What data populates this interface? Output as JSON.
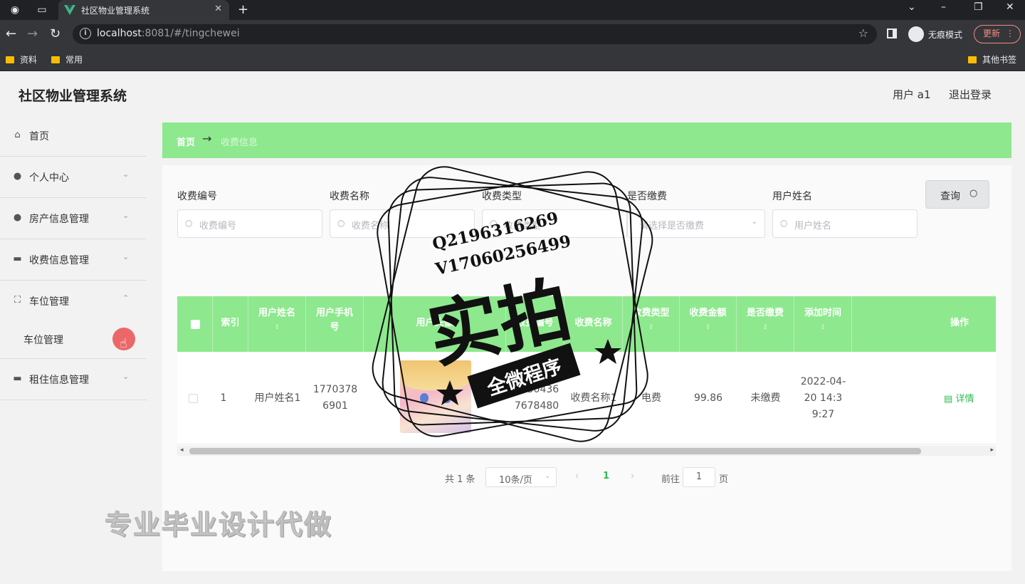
{
  "browser": {
    "tab_title": "社区物业管理系统",
    "url_host": "localhost",
    "url_rest": ":8081/#/tingchewei",
    "incognito_label": "无痕模式",
    "update_label": "更新",
    "bookmarks": [
      "资料",
      "常用"
    ],
    "other_bookmarks": "其他书签"
  },
  "app": {
    "title": "社区物业管理系统",
    "user_label": "用户 a1",
    "logout_label": "退出登录"
  },
  "sidebar": {
    "items": [
      {
        "label": "首页",
        "icon": "home-icon"
      },
      {
        "label": "个人中心",
        "icon": "user-icon"
      },
      {
        "label": "房产信息管理",
        "icon": "user-icon"
      },
      {
        "label": "收费信息管理",
        "icon": "monitor-icon"
      },
      {
        "label": "车位管理",
        "icon": "fullscreen-icon"
      },
      {
        "label": "租住信息管理",
        "icon": "monitor-icon"
      }
    ],
    "sub_item": "车位管理"
  },
  "breadcrumb": {
    "home": "首页",
    "current": "收费信息"
  },
  "filters": {
    "fields": [
      {
        "label": "收费编号",
        "placeholder": "收费编号"
      },
      {
        "label": "收费名称",
        "placeholder": "收费名称"
      },
      {
        "label": "收费类型",
        "placeholder": "收费类型"
      },
      {
        "label": "是否缴费",
        "placeholder": "请选择是否缴费"
      },
      {
        "label": "用户姓名",
        "placeholder": "用户姓名"
      }
    ],
    "query_label": "查询"
  },
  "table": {
    "columns": [
      "索引",
      "用户姓名",
      "用户手机号",
      "用户头像",
      "收费编号",
      "收费名称",
      "收费类型",
      "收费金额",
      "是否缴费",
      "添加时间",
      "操作"
    ],
    "rows": [
      {
        "index": "1",
        "user_name": "用户姓名1",
        "phone": "17703786901",
        "fee_no": "16504367678480",
        "fee_name": "收费名称1",
        "fee_type": "电费",
        "amount": "99.86",
        "paid": "未缴费",
        "added": "2022-04-20 14:39:27",
        "action": "详情"
      }
    ]
  },
  "pagination": {
    "total": "共 1 条",
    "page_size": "10条/页",
    "current_page": "1",
    "goto_label": "前往",
    "goto_value": "1",
    "page_suffix": "页"
  },
  "watermark": {
    "contact_q": "Q2196316269",
    "contact_v": "V17060256499",
    "big_text": "实拍",
    "ribbon": "全微程序",
    "footer": "专业毕业设计代做"
  },
  "colors": {
    "accent_green": "#8ee88e",
    "link_green": "#2ebc4f",
    "page_bg": "#f2f2f2"
  }
}
